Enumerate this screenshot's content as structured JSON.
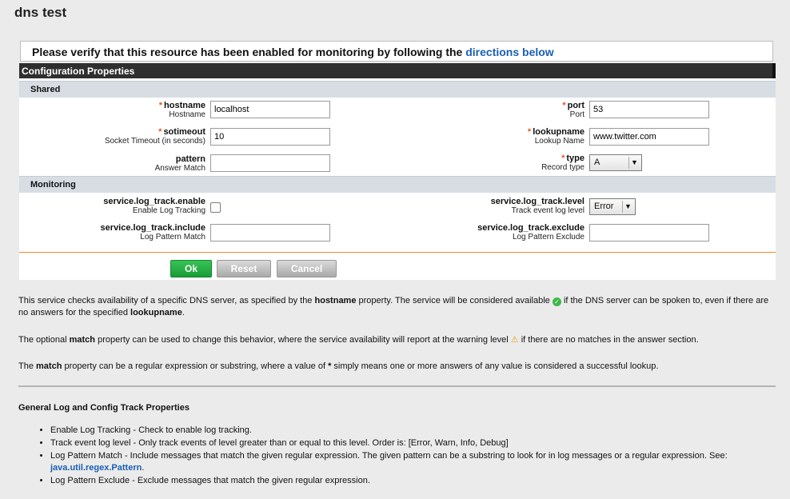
{
  "page": {
    "title": "dns test"
  },
  "notice": {
    "text": "Please verify that this resource has been enabled for monitoring by following the",
    "link": "directions below"
  },
  "panel": {
    "title": "Configuration Properties",
    "sections": {
      "shared": "Shared",
      "monitoring": "Monitoring"
    }
  },
  "fields": {
    "hostname": {
      "key": "hostname",
      "desc": "Hostname",
      "value": "localhost",
      "required": "*"
    },
    "port": {
      "key": "port",
      "desc": "Port",
      "value": "53",
      "required": "*"
    },
    "sotimeout": {
      "key": "sotimeout",
      "desc": "Socket Timeout (in seconds)",
      "value": "10",
      "required": "*"
    },
    "lookupname": {
      "key": "lookupname",
      "desc": "Lookup Name",
      "value": "www.twitter.com",
      "required": "*"
    },
    "pattern": {
      "key": "pattern",
      "desc": "Answer Match",
      "value": ""
    },
    "type": {
      "key": "type",
      "desc": "Record type",
      "value": "A",
      "required": "*"
    },
    "log_enable": {
      "key": "service.log_track.enable",
      "desc": "Enable Log Tracking",
      "checked": false
    },
    "log_level": {
      "key": "service.log_track.level",
      "desc": "Track event log level",
      "value": "Error"
    },
    "log_include": {
      "key": "service.log_track.include",
      "desc": "Log Pattern Match",
      "value": ""
    },
    "log_exclude": {
      "key": "service.log_track.exclude",
      "desc": "Log Pattern Exclude",
      "value": ""
    }
  },
  "buttons": {
    "ok": "Ok",
    "reset": "Reset",
    "cancel": "Cancel"
  },
  "help": {
    "p1": {
      "a": "This service checks availability of a specific DNS server, as specified by the",
      "b": "hostname",
      "c": "property. The service will be considered available",
      "d": "if the DNS server can be spoken to, even if there are no answers for the specified",
      "e": "lookupname",
      "f": "."
    },
    "p2": {
      "a": "The optional",
      "b": "match",
      "c": "property can be used to change this behavior, where the service availability will report at the warning level",
      "d": "if there are no matches in the answer section."
    },
    "p3": {
      "a": "The",
      "b": "match",
      "c": "property can be a regular expression or substring, where a value of",
      "d": "*",
      "e": "simply means one or more answers of any value is considered a successful lookup."
    }
  },
  "general": {
    "title": "General Log and Config Track Properties",
    "items": [
      "Enable Log Tracking - Check to enable log tracking.",
      "Track event log level - Only track events of level greater than or equal to this level. Order is: [Error, Warn, Info, Debug]",
      "Log Pattern Match - Include messages that match the given regular expression. The given pattern can be a substring to look for in log messages or a regular expression. See:",
      "Log Pattern Exclude - Exclude messages that match the given regular expression."
    ],
    "link": "java.util.regex.Pattern",
    "link_suffix": "."
  },
  "icons": {
    "ok": "check-circle-icon",
    "warning": "warning-triangle-icon",
    "dropdown": "chevron-down-icon"
  },
  "colors": {
    "required": "#e05a2b",
    "ok_button": "#1a9c37",
    "link": "#1a5fb4",
    "divider": "#f08a2e"
  }
}
